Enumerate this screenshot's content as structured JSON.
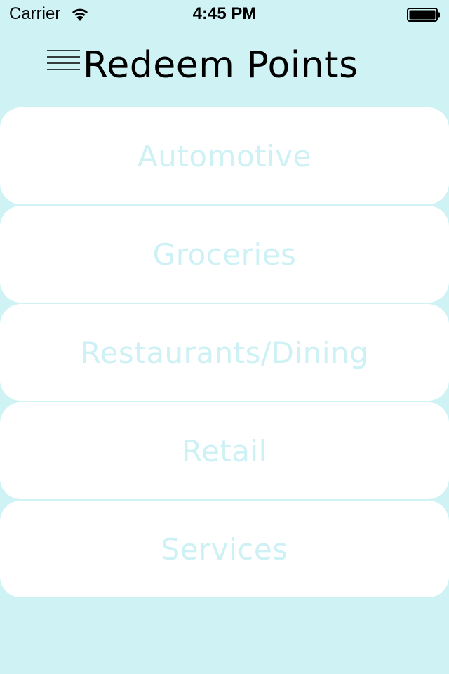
{
  "status_bar": {
    "carrier": "Carrier",
    "time": "4:45 PM",
    "wifi_icon": "wifi-icon",
    "battery_icon": "battery-full-icon",
    "battery_level": 1.0
  },
  "header": {
    "menu_icon": "hamburger-menu-icon",
    "title": "Redeem Points"
  },
  "categories": [
    {
      "label": "Automotive"
    },
    {
      "label": "Groceries"
    },
    {
      "label": "Restaurants/Dining"
    },
    {
      "label": "Retail"
    },
    {
      "label": "Services"
    }
  ],
  "colors": {
    "background": "#cff2f4",
    "card": "#ffffff",
    "card_text": "#cdf1f4",
    "title_text": "#000000"
  }
}
